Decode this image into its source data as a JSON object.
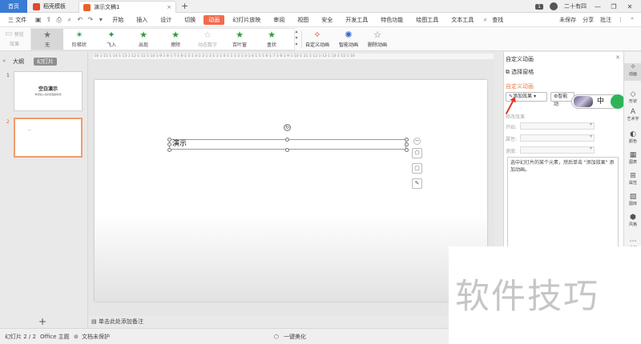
{
  "titlebar": {
    "home": "首页",
    "template_tab": "稻壳模板",
    "doc_tab": "演示文稿1",
    "close": "×",
    "add": "+",
    "count": "1",
    "user": "二十有四",
    "win_min": "—",
    "win_max": "❐",
    "win_close": "✕"
  },
  "menubar": {
    "file": "三 文件",
    "items": [
      "开始",
      "插入",
      "设计",
      "切换",
      "动画",
      "幻灯片放映",
      "审阅",
      "视图",
      "安全",
      "开发工具",
      "特色功能",
      "绘图工具",
      "文本工具"
    ],
    "active_index": 4,
    "search": "查找",
    "unsaved": "未保存",
    "share": "分享",
    "comment": "批注"
  },
  "ribbon": {
    "preview": "预览效果",
    "effects": [
      "无",
      "阶梯状",
      "飞入",
      "出现",
      "擦除",
      "动态数字",
      "百叶窗",
      "盒状"
    ],
    "custom_anim": "自定义动画",
    "smart_anim": "智能动画",
    "delete_anim": "删除动画"
  },
  "leftpanel": {
    "tab_outline": "大纲",
    "tab_slides": "幻灯片",
    "thumb1_num": "1",
    "thumb1_title": "空白演示",
    "thumb1_sub": "单击输入您的封面副标题",
    "thumb2_num": "2",
    "thumb2_text": "..",
    "add": "+"
  },
  "ruler": "·16·1·15·1·14·1·13·1·12·1·11·1·10·1·9·1·8·1·7·1·6·1·5·1·4·1·3·1·2·1·1·1·0·1·1·1·2·1·3·1·4·1·5·1·6·1·7·1·8·1·9·1·10·1·11·1·12·1·13·1·14·1·15·1·16·",
  "slide": {
    "text": "演示"
  },
  "notes": "单击此处添加备注",
  "statusbar": {
    "slide": "幻灯片 2 / 2",
    "theme": "Office 主题",
    "protect": "文档未保护",
    "beautify": "一键美化"
  },
  "rightpanel": {
    "title": "自定义动画",
    "select_pane": "选择窗格",
    "section": "自定义动画",
    "add_effect": "添加效果",
    "smart": "智能动",
    "modify": "修改效果",
    "start": "开始:",
    "property": "属性:",
    "speed": "速度:",
    "hint": "选中幻灯片的某个元素，然后单击 \"添加效果\" 添加动画。",
    "sticker_char": "中"
  },
  "sidebar": {
    "items": [
      "动画",
      "形状",
      "艺术字",
      "颜色",
      "图表",
      "属性",
      "图库",
      "风格",
      "设置"
    ]
  },
  "watermark": "软件技巧"
}
